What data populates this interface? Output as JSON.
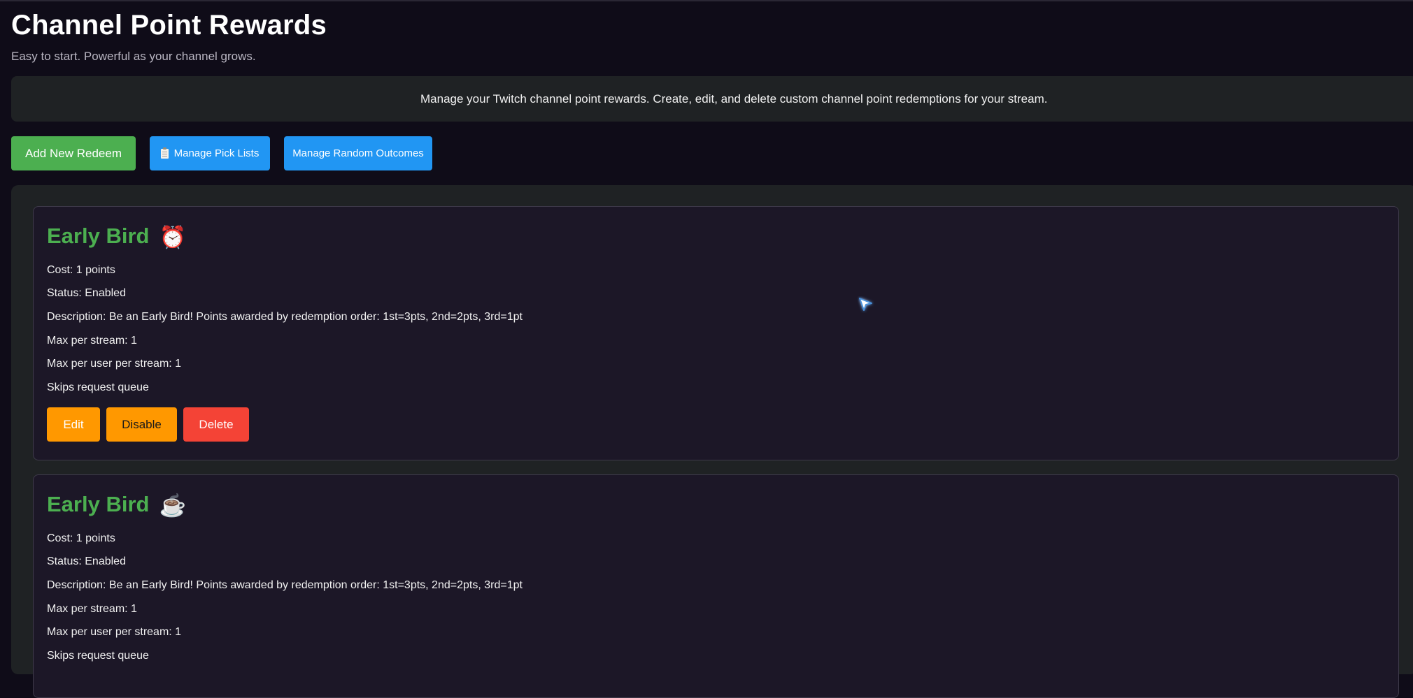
{
  "header": {
    "title": "Channel Point Rewards",
    "subtitle": "Easy to start. Powerful as your channel grows."
  },
  "info": {
    "text": "Manage your Twitch channel point rewards. Create, edit, and delete custom channel point redemptions for your stream."
  },
  "toolbar": {
    "add_label": "Add New Redeem",
    "picklists_label": "Manage Pick Lists",
    "picklists_icon": "clipboard-icon",
    "random_label": "Manage Random Outcomes"
  },
  "rewards": [
    {
      "title": "Early Bird",
      "emoji": "⏰",
      "cost": "Cost: 1 points",
      "status": "Status: Enabled",
      "description": "Description: Be an Early Bird! Points awarded by redemption order: 1st=3pts, 2nd=2pts, 3rd=1pt",
      "max_stream": "Max per stream: 1",
      "max_user": "Max per user per stream: 1",
      "queue": "Skips request queue",
      "edit_label": "Edit",
      "disable_label": "Disable",
      "delete_label": "Delete"
    },
    {
      "title": "Early Bird",
      "emoji": "☕",
      "cost": "Cost: 1 points",
      "status": "Status: Enabled",
      "description": "Description: Be an Early Bird! Points awarded by redemption order: 1st=3pts, 2nd=2pts, 3rd=1pt",
      "max_stream": "Max per stream: 1",
      "max_user": "Max per user per stream: 1",
      "queue": "Skips request queue"
    }
  ],
  "colors": {
    "background": "#0f0c18",
    "panel": "#1f2224",
    "card": "#1c1727",
    "accent_green": "#4caf50",
    "accent_blue": "#2196f3",
    "accent_orange": "#ff9800",
    "accent_red": "#f44336"
  }
}
